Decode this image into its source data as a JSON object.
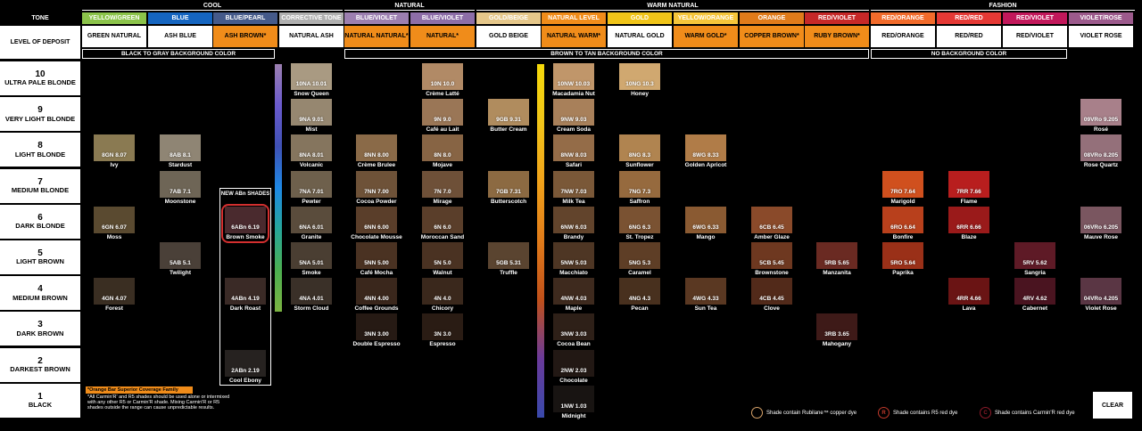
{
  "header": {
    "tone_label": "TONE",
    "level_label": "LEVEL OF DEPOSIT",
    "families": [
      "COOL",
      "NATURAL",
      "WARM NATURAL",
      "FASHION"
    ],
    "tones": [
      "YELLOW/GREEN",
      "BLUE",
      "BLUE/PEARL",
      "CORRECTIVE TONE",
      "BLUE/VIOLET",
      "BLUE/VIOLET",
      "GOLD/BEIGE",
      "NATURAL LEVEL",
      "GOLD",
      "YELLOW/ORANGE",
      "ORANGE",
      "RED/VIOLET",
      "RED/ORANGE",
      "RED/RED",
      "RED/VIOLET",
      "VIOLET/ROSE"
    ],
    "deposits": [
      "GREEN NATURAL",
      "ASH BLUE",
      "ASH BROWN*",
      "NATURAL ASH",
      "NATURAL NATURAL*",
      "NATURAL*",
      "GOLD BEIGE",
      "NATURAL WARM*",
      "NATURAL GOLD",
      "WARM GOLD*",
      "COPPER BROWN*",
      "RUBY BROWN*",
      "RED/ORANGE",
      "RED/RED",
      "RED/VIOLET",
      "VIOLET ROSE"
    ],
    "tone_colors": [
      "#8bc34a",
      "#1565c0",
      "#455a8a",
      "#b0b0b0",
      "#9c7fb0",
      "#8d6ea8",
      "#e5c78a",
      "#f08c1a",
      "#f0c419",
      "#f5c53a",
      "#e07b1a",
      "#c62828",
      "#f26b2b",
      "#e53935",
      "#c2185b",
      "#9c5a8c"
    ],
    "deposit_colors": [
      "#fff",
      "#fff",
      "#f08c1a",
      "#fff",
      "#f08c1a",
      "#f08c1a",
      "#fff",
      "#f08c1a",
      "#fff",
      "#f08c1a",
      "#f08c1a",
      "#f08c1a",
      "#fff",
      "#fff",
      "#fff",
      "#fff"
    ]
  },
  "bars": {
    "black_to_gray": "BLACK TO GRAY BACKGROUND COLOR",
    "brown_to_tan": "BROWN TO TAN BACKGROUND COLOR",
    "no_background": "NO BACKGROUND COLOR"
  },
  "levels": [
    {
      "num": "10",
      "name": "ULTRA PALE BLONDE"
    },
    {
      "num": "9",
      "name": "VERY LIGHT BLONDE"
    },
    {
      "num": "8",
      "name": "LIGHT BLONDE"
    },
    {
      "num": "7",
      "name": "MEDIUM BLONDE"
    },
    {
      "num": "6",
      "name": "DARK BLONDE"
    },
    {
      "num": "5",
      "name": "LIGHT BROWN"
    },
    {
      "num": "4",
      "name": "MEDIUM BROWN"
    },
    {
      "num": "3",
      "name": "DARK BROWN"
    },
    {
      "num": "2",
      "name": "DARKEST BROWN"
    },
    {
      "num": "1",
      "name": "BLACK"
    }
  ],
  "new_abn_label": "NEW ABn SHADES",
  "swatches": [
    {
      "code": "8GN 8.07",
      "name": "Ivy",
      "col": 0,
      "lvl": 8,
      "color": "#8a7a52"
    },
    {
      "code": "6GN 6.07",
      "name": "Moss",
      "col": 0,
      "lvl": 6,
      "color": "#5a4a30"
    },
    {
      "code": "4GN 4.07",
      "name": "Forest",
      "col": 0,
      "lvl": 4,
      "color": "#3a2e22"
    },
    {
      "code": "8AB 8.1",
      "name": "Stardust",
      "col": 1,
      "lvl": 8,
      "color": "#8f8574"
    },
    {
      "code": "7AB 7.1",
      "name": "Moonstone",
      "col": 1,
      "lvl": 7,
      "color": "#6e6556"
    },
    {
      "code": "5AB 5.1",
      "name": "Twilight",
      "col": 1,
      "lvl": 5,
      "color": "#4a4038"
    },
    {
      "code": "6ABn 6.19",
      "name": "Brown Smoke",
      "col": 2,
      "lvl": 6,
      "color": "#4a2a2e"
    },
    {
      "code": "4ABn 4.19",
      "name": "Dark Roast",
      "col": 2,
      "lvl": 4,
      "color": "#3a2a26"
    },
    {
      "code": "2ABn 2.19",
      "name": "Cool Ebony",
      "col": 2,
      "lvl": 2,
      "color": "#262220"
    },
    {
      "code": "10NA 10.01",
      "name": "Snow Queen",
      "col": 3,
      "lvl": 10,
      "color": "#a99a82"
    },
    {
      "code": "9NA 9.01",
      "name": "Mist",
      "col": 3,
      "lvl": 9,
      "color": "#968770"
    },
    {
      "code": "8NA 8.01",
      "name": "Volcanic",
      "col": 3,
      "lvl": 8,
      "color": "#85755e"
    },
    {
      "code": "7NA 7.01",
      "name": "Pewter",
      "col": 3,
      "lvl": 7,
      "color": "#6e604c"
    },
    {
      "code": "6NA 6.01",
      "name": "Granite",
      "col": 3,
      "lvl": 6,
      "color": "#5a4c3c"
    },
    {
      "code": "5NA 5.01",
      "name": "Smoke",
      "col": 3,
      "lvl": 5,
      "color": "#4a3e32"
    },
    {
      "code": "4NA 4.01",
      "name": "Storm Cloud",
      "col": 3,
      "lvl": 4,
      "color": "#3a3028"
    },
    {
      "code": "8NN 8.00",
      "name": "Crème Brulee",
      "col": 4,
      "lvl": 8,
      "color": "#8a6a48"
    },
    {
      "code": "7NN 7.00",
      "name": "Cocoa Powder",
      "col": 4,
      "lvl": 7,
      "color": "#6e5238"
    },
    {
      "code": "6NN 6.00",
      "name": "Chocolate Mousse",
      "col": 4,
      "lvl": 6,
      "color": "#5a3e2a"
    },
    {
      "code": "5NN 5.00",
      "name": "Café Mocha",
      "col": 4,
      "lvl": 5,
      "color": "#4a3222"
    },
    {
      "code": "4NN 4.00",
      "name": "Coffee Grounds",
      "col": 4,
      "lvl": 4,
      "color": "#3a271c"
    },
    {
      "code": "3NN 3.00",
      "name": "Double Espresso",
      "col": 4,
      "lvl": 3,
      "color": "#261a14"
    },
    {
      "code": "10N 10.0",
      "name": "Crème Latté",
      "col": 5,
      "lvl": 10,
      "color": "#b18a66"
    },
    {
      "code": "9N 9.0",
      "name": "Café au Lait",
      "col": 5,
      "lvl": 9,
      "color": "#9a7656"
    },
    {
      "code": "8N 8.0",
      "name": "Mojave",
      "col": 5,
      "lvl": 8,
      "color": "#876444"
    },
    {
      "code": "7N 7.0",
      "name": "Mirage",
      "col": 5,
      "lvl": 7,
      "color": "#6e5038"
    },
    {
      "code": "6N 6.0",
      "name": "Moroccan Sand",
      "col": 5,
      "lvl": 6,
      "color": "#5a3e2a"
    },
    {
      "code": "5N 5.0",
      "name": "Walnut",
      "col": 5,
      "lvl": 5,
      "color": "#4a3222"
    },
    {
      "code": "4N 4.0",
      "name": "Chicory",
      "col": 5,
      "lvl": 4,
      "color": "#3a281c"
    },
    {
      "code": "3N 3.0",
      "name": "Espresso",
      "col": 5,
      "lvl": 3,
      "color": "#2a1c14"
    },
    {
      "code": "9GB 9.31",
      "name": "Butter Cream",
      "col": 6,
      "lvl": 9,
      "color": "#b08c5e"
    },
    {
      "code": "7GB 7.31",
      "name": "Butterscotch",
      "col": 6,
      "lvl": 7,
      "color": "#8c6a42"
    },
    {
      "code": "5GB 5.31",
      "name": "Truffle",
      "col": 6,
      "lvl": 5,
      "color": "#5a4430"
    },
    {
      "code": "10NW 10.03",
      "name": "Macadamia Nut",
      "col": 7,
      "lvl": 10,
      "color": "#c0966a"
    },
    {
      "code": "9NW 9.03",
      "name": "Cream Soda",
      "col": 7,
      "lvl": 9,
      "color": "#a8805a"
    },
    {
      "code": "8NW 8.03",
      "name": "Safari",
      "col": 7,
      "lvl": 8,
      "color": "#946c48"
    },
    {
      "code": "7NW 7.03",
      "name": "Milk Tea",
      "col": 7,
      "lvl": 7,
      "color": "#7a5838"
    },
    {
      "code": "6NW 6.03",
      "name": "Brandy",
      "col": 7,
      "lvl": 6,
      "color": "#62442c"
    },
    {
      "code": "5NW 5.03",
      "name": "Macchiato",
      "col": 7,
      "lvl": 5,
      "color": "#4e3624"
    },
    {
      "code": "4NW 4.03",
      "name": "Maple",
      "col": 7,
      "lvl": 4,
      "color": "#3e2a1e"
    },
    {
      "code": "3NW 3.03",
      "name": "Cocoa Bean",
      "col": 7,
      "lvl": 3,
      "color": "#2e2018"
    },
    {
      "code": "2NW 2.03",
      "name": "Chocolate",
      "col": 7,
      "lvl": 2,
      "color": "#221814"
    },
    {
      "code": "1NW 1.03",
      "name": "Midnight",
      "col": 7,
      "lvl": 1,
      "color": "#181412"
    },
    {
      "code": "10NG 10.3",
      "name": "Honey",
      "col": 8,
      "lvl": 10,
      "color": "#d0a870"
    },
    {
      "code": "8NG 8.3",
      "name": "Sunflower",
      "col": 8,
      "lvl": 8,
      "color": "#b08450"
    },
    {
      "code": "7NG 7.3",
      "name": "Saffron",
      "col": 8,
      "lvl": 7,
      "color": "#966a3e"
    },
    {
      "code": "6NG 6.3",
      "name": "St. Tropez",
      "col": 8,
      "lvl": 6,
      "color": "#7a5232"
    },
    {
      "code": "5NG 5.3",
      "name": "Caramel",
      "col": 8,
      "lvl": 5,
      "color": "#5e3e26"
    },
    {
      "code": "4NG 4.3",
      "name": "Pecan",
      "col": 8,
      "lvl": 4,
      "color": "#48301e"
    },
    {
      "code": "8WG 8.33",
      "name": "Golden Apricot",
      "col": 9,
      "lvl": 8,
      "color": "#b07c48"
    },
    {
      "code": "6WG 6.33",
      "name": "Mango",
      "col": 9,
      "lvl": 6,
      "color": "#8a5a32"
    },
    {
      "code": "4WG 4.33",
      "name": "Sun Tea",
      "col": 9,
      "lvl": 4,
      "color": "#5a3822"
    },
    {
      "code": "6CB 6.45",
      "name": "Amber Glaze",
      "col": 10,
      "lvl": 6,
      "color": "#8a4a2a"
    },
    {
      "code": "5CB 5.45",
      "name": "Brownstone",
      "col": 10,
      "lvl": 5,
      "color": "#6e3820"
    },
    {
      "code": "4CB 4.45",
      "name": "Clove",
      "col": 10,
      "lvl": 4,
      "color": "#522a1a"
    },
    {
      "code": "5RB 5.65",
      "name": "Manzanita",
      "col": 11,
      "lvl": 5,
      "color": "#6a2a22"
    },
    {
      "code": "3RB 3.65",
      "name": "Mahogany",
      "col": 11,
      "lvl": 3,
      "color": "#3e1a18"
    },
    {
      "code": "7RO 7.64",
      "name": "Marigold",
      "col": 12,
      "lvl": 7,
      "color": "#d0501e",
      "rub": true
    },
    {
      "code": "6RO 6.64",
      "name": "Bonfire",
      "col": 12,
      "lvl": 6,
      "color": "#b8401c",
      "rub": true
    },
    {
      "code": "5RO 5.64",
      "name": "Paprika",
      "col": 12,
      "lvl": 5,
      "color": "#9a3018",
      "rub": true
    },
    {
      "code": "7RR 7.66",
      "name": "Flame",
      "col": 13,
      "lvl": 7,
      "color": "#b81e1e",
      "r5": true
    },
    {
      "code": "6RR 6.66",
      "name": "Blaze",
      "col": 13,
      "lvl": 6,
      "color": "#9a1a1a",
      "r5": true
    },
    {
      "code": "4RR 4.66",
      "name": "Lava",
      "col": 13,
      "lvl": 4,
      "color": "#6a1414",
      "r5": true
    },
    {
      "code": "5RV 5.62",
      "name": "Sangria",
      "col": 14,
      "lvl": 5,
      "color": "#5e1a26",
      "car": true
    },
    {
      "code": "4RV 4.62",
      "name": "Cabernet",
      "col": 14,
      "lvl": 4,
      "color": "#4a1420",
      "car": true
    },
    {
      "code": "09VRo 9.205",
      "name": "Rosé",
      "col": 15,
      "lvl": 9,
      "color": "#a8808a"
    },
    {
      "code": "08VRo 8.205",
      "name": "Rose Quartz",
      "col": 15,
      "lvl": 8,
      "color": "#94707a"
    },
    {
      "code": "06VRo 6.205",
      "name": "Mauve Rose",
      "col": 15,
      "lvl": 6,
      "color": "#7a5660"
    },
    {
      "code": "04VRo 4.205",
      "name": "Violet Rose",
      "col": 15,
      "lvl": 4,
      "color": "#5a3644"
    }
  ],
  "notes": {
    "orange_bar": "*Orange Bar Superior Coverage Family",
    "carmin": "*All Carmin'R' and R5 shades should be used alone or intermixed with any other R5 or Carmin'R shade. Mixing Carmin'R or R5 shades outside the range can cause unpredictable results."
  },
  "legend": [
    {
      "icon": "rubilane-icon",
      "text": "Shade contain  Rubilane™ copper dye",
      "color": "#d9a46a"
    },
    {
      "icon": "r5-icon",
      "text": "Shade contains  R5 red dye",
      "color": "#c0392b"
    },
    {
      "icon": "carmin-icon",
      "text": "Shade contains Carmin'R red dye",
      "color": "#8e1b2a"
    }
  ],
  "clear_label": "CLEAR"
}
